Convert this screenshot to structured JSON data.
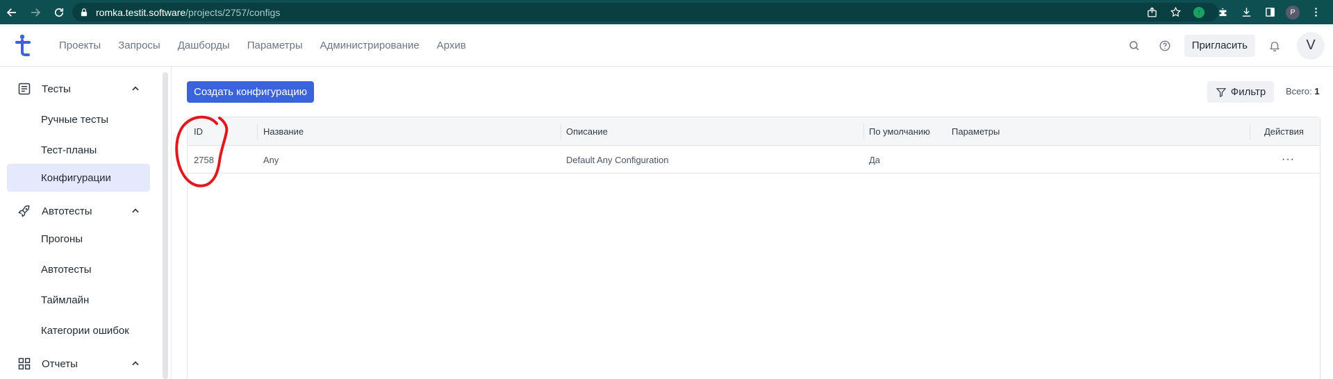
{
  "browser": {
    "url_host": "romka.testit.software",
    "url_path": "/projects/2757/configs",
    "profile_initial": "P",
    "icons": [
      "back-icon",
      "forward-icon",
      "reload-icon",
      "lock-icon",
      "share-icon",
      "star-icon",
      "extension-icon",
      "puzzle-icon",
      "download-icon",
      "sidepanel-icon",
      "menu-icon"
    ]
  },
  "header": {
    "nav": [
      "Проекты",
      "Запросы",
      "Дашборды",
      "Параметры",
      "Администрирование",
      "Архив"
    ],
    "invite_label": "Пригласить",
    "avatar_initial": "V",
    "brand_color": "#3a63dc"
  },
  "sidebar": {
    "sections": [
      {
        "label": "Тесты",
        "icon": "document-icon",
        "items": [
          "Ручные тесты",
          "Тест-планы",
          "Конфигурации"
        ],
        "active": "Конфигурации"
      },
      {
        "label": "Автотесты",
        "icon": "rocket-icon",
        "items": [
          "Прогоны",
          "Автотесты",
          "Таймлайн",
          "Категории ошибок"
        ]
      },
      {
        "label": "Отчеты",
        "icon": "grid-icon",
        "items": []
      }
    ]
  },
  "main": {
    "create_label": "Создать конфигурацию",
    "filter_label": "Фильтр",
    "total_label": "Всего:",
    "total_value": "1",
    "table": {
      "columns": [
        "ID",
        "Название",
        "Описание",
        "По умолчанию",
        "Параметры",
        "Действия"
      ],
      "rows": [
        {
          "id": "2758",
          "name": "Any",
          "description": "Default Any Configuration",
          "default": "Да",
          "params": "",
          "actions": "···"
        }
      ]
    }
  },
  "annotation": {
    "color": "#e0191f",
    "shape": "hand-drawn circle around ID column"
  }
}
